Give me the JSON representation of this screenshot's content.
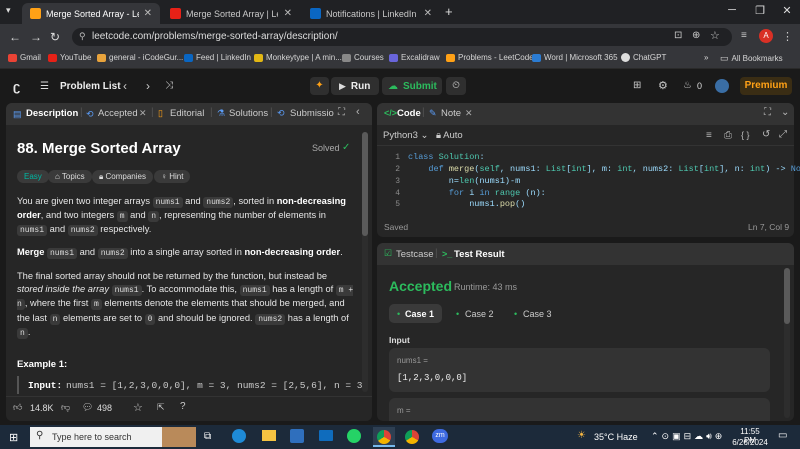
{
  "browser": {
    "tabs": [
      {
        "title": "Merge Sorted Array - LeetCode",
        "active": true
      },
      {
        "title": "Merge Sorted Array | Leetcode",
        "active": false
      },
      {
        "title": "Notifications | LinkedIn",
        "active": false
      }
    ],
    "url": "leetcode.com/problems/merge-sorted-array/description/",
    "profile_initial": "A",
    "bookmarks": [
      "Gmail",
      "YouTube",
      "general - iCodeGur...",
      "Feed | LinkedIn",
      "Monkeytype | A min...",
      "Courses",
      "Excalidraw",
      "Problems - LeetCode",
      "Word | Microsoft 365",
      "ChatGPT"
    ],
    "all_bookmarks": "All Bookmarks"
  },
  "header": {
    "problem_list": "Problem List",
    "run": "Run",
    "submit": "Submit",
    "notifications": "0",
    "premium": "Premium"
  },
  "left_tabs": {
    "description": "Description",
    "accepted": "Accepted",
    "editorial": "Editorial",
    "solutions": "Solutions",
    "submissions": "Submissio"
  },
  "problem": {
    "title": "88. Merge Sorted Array",
    "status": "Solved",
    "difficulty": "Easy",
    "topics": "Topics",
    "companies": "Companies",
    "hint": "Hint",
    "example_heading": "Example 1:",
    "example_input_label": "Input:",
    "example_input": "nums1 = [1,2,3,0,0,0], m = 3, nums2 = [2,5,6], n = 3",
    "likes": "14.8K",
    "comments": "498"
  },
  "desc": {
    "p1": {
      "a": "You are given two integer arrays ",
      "c1": "nums1",
      "b": " and ",
      "c2": "nums2",
      "d": ", sorted in ",
      "bold1": "non-decreasing order",
      "e": ", and two integers ",
      "c3": "m",
      "f": " and ",
      "c4": "n",
      "g": ", representing the number of elements in ",
      "c5": "nums1",
      "h": " and ",
      "c6": "nums2",
      "i": " respectively."
    },
    "p2": {
      "bold1": "Merge",
      "c1": "nums1",
      "a": " and ",
      "c2": "nums2",
      "b": " into a single array sorted in ",
      "bold2": "non-decreasing order",
      "c": "."
    },
    "p3": {
      "a": "The final sorted array should not be returned by the function, but instead be ",
      "em1": "stored inside the array",
      "c1": "nums1",
      "b": ". To accommodate this, ",
      "c2": "nums1",
      "c": " has a length of ",
      "c3": "m + n",
      "d": ", where the first ",
      "c4": "m",
      "e": " elements denote the elements that should be merged, and the last ",
      "c5": "n",
      "f": " elements are set to ",
      "c6": "0",
      "g": " and should be ignored. ",
      "c7": "nums2",
      "h": " has a length of ",
      "c8": "n",
      "i": "."
    }
  },
  "code_panel": {
    "tab_code": "Code",
    "tab_note": "Note",
    "language": "Python3",
    "auto": "Auto",
    "lines": [
      {
        "n": "1",
        "text": "class Solution:"
      },
      {
        "n": "2",
        "text": "    def merge(self, nums1: List[int], m: int, nums2: List[int], n: int) -> None:"
      },
      {
        "n": "3",
        "text": "        n=len(nums1)-m"
      },
      {
        "n": "4",
        "text": "        for i in range (n):"
      },
      {
        "n": "5",
        "text": "            nums1.pop()"
      }
    ],
    "saved": "Saved",
    "cursor": "Ln 7, Col 9"
  },
  "result_panel": {
    "tab_testcase": "Testcase",
    "tab_result": "Test Result",
    "verdict": "Accepted",
    "runtime": "Runtime: 43 ms",
    "cases": [
      "Case 1",
      "Case 2",
      "Case 3"
    ],
    "input_label": "Input",
    "var1_name": "nums1 =",
    "var1_value": "[1,2,3,0,0,0]",
    "var2_name": "m ="
  },
  "taskbar": {
    "search_placeholder": "Type here to search",
    "weather": "35°C  Haze",
    "time": "11:55 PM",
    "date": "6/26/2024"
  },
  "colors": {
    "accent_orange": "#ffa116",
    "green": "#2cbb5d",
    "easy": "#00b8a3",
    "premium": "#ffa116"
  }
}
